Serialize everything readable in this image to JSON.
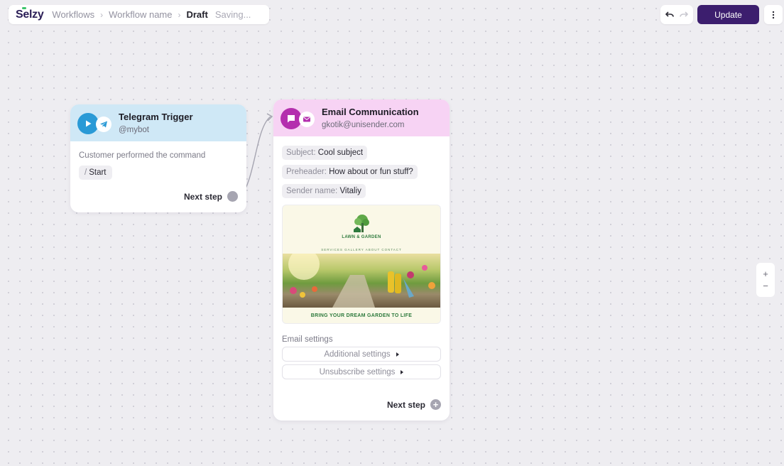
{
  "app": {
    "logo": "Selzy"
  },
  "breadcrumb": {
    "items": [
      "Workflows",
      "Workflow name"
    ],
    "current": "Draft",
    "status": "Saving..."
  },
  "toolbar": {
    "update_label": "Update"
  },
  "zoom": {
    "plus": "+",
    "minus": "−"
  },
  "telegram_card": {
    "title": "Telegram Trigger",
    "subtitle": "@mybot",
    "description": "Customer performed the command",
    "command_slash": "/",
    "command": "Start",
    "next_step": "Next step"
  },
  "email_card": {
    "title": "Email Communication",
    "subtitle": "gkotik@unisender.com",
    "fields": [
      {
        "key": "Subject:",
        "value": "Cool subject"
      },
      {
        "key": "Preheader:",
        "value": "How about or fun stuff?"
      },
      {
        "key": "Sender name:",
        "value": "Vitaliy"
      }
    ],
    "preview": {
      "logo_text": "LAWN & GARDEN",
      "nav": "SERVICES  GALLERY  ABOUT  CONTACT",
      "caption": "BRING YOUR DREAM GARDEN TO LIFE"
    },
    "settings_label": "Email settings",
    "settings": [
      "Additional settings",
      "Unsubscribe settings"
    ],
    "next_step": "Next step"
  },
  "colors": {
    "accent": "#3c1e6e",
    "telegram_header": "#cfe8f6",
    "email_header": "#f7d3f4",
    "telegram_icon": "#2a9ad6",
    "email_icon": "#b42fae"
  }
}
